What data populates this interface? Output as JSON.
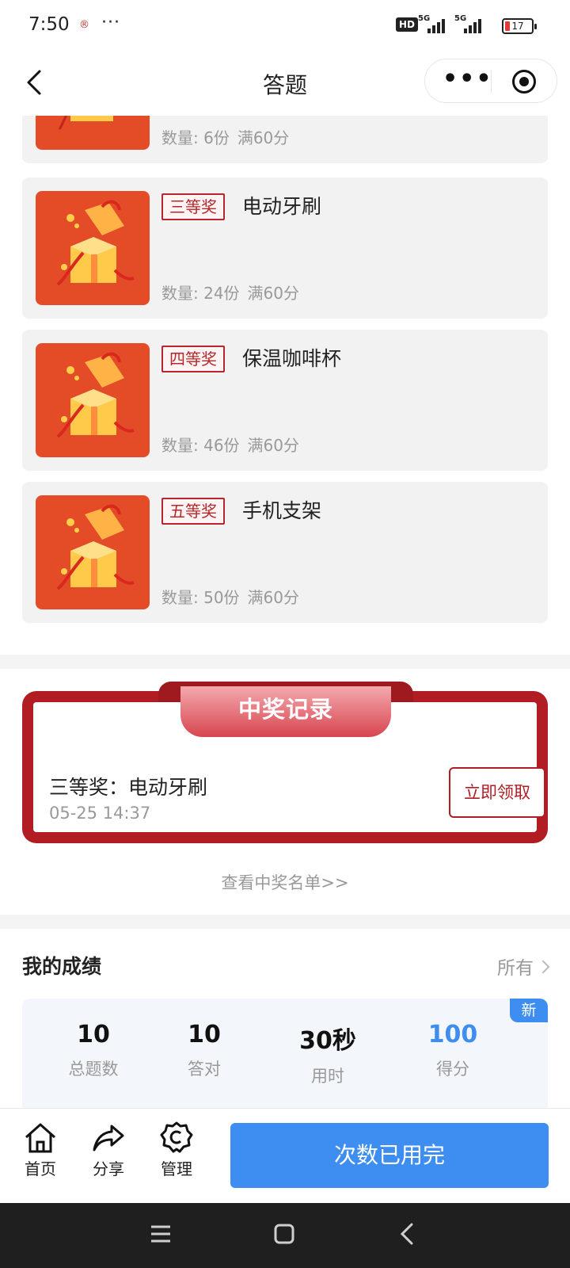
{
  "status_bar": {
    "time": "7:50",
    "app_glyph": "®",
    "dots": "···",
    "hd": "HD",
    "sim1": "5G",
    "sim2": "5G",
    "battery": "17"
  },
  "nav": {
    "title": "答题",
    "more_glyph": "•••"
  },
  "prizes": [
    {
      "badge": "",
      "name": "",
      "quantity": "数量: 6份",
      "threshold": "满60分"
    },
    {
      "badge": "三等奖",
      "name": "电动牙刷",
      "quantity": "数量: 24份",
      "threshold": "满60分"
    },
    {
      "badge": "四等奖",
      "name": "保温咖啡杯",
      "quantity": "数量: 46份",
      "threshold": "满60分"
    },
    {
      "badge": "五等奖",
      "name": "手机支架",
      "quantity": "数量: 50份",
      "threshold": "满60分"
    }
  ],
  "records": {
    "ribbon_title": "中奖记录",
    "entry_title": "三等奖：电动牙刷",
    "entry_time": "05-25 14:37",
    "claim_label": "立即领取",
    "view_list_link": "查看中奖名单>>"
  },
  "scores": {
    "heading": "我的成绩",
    "all_link": "所有",
    "new_tag": "新",
    "stats": [
      {
        "value": "10",
        "label": "总题数"
      },
      {
        "value": "10",
        "label": "答对"
      },
      {
        "value": "30秒",
        "label": "用时"
      },
      {
        "value": "100",
        "label": "得分"
      }
    ]
  },
  "bottom_bar": {
    "home": "首页",
    "share": "分享",
    "manage": "管理",
    "main_button": "次数已用完"
  },
  "colors": {
    "accent_red": "#b11d23",
    "accent_blue": "#3d8ef0",
    "thumb_orange": "#e44c27"
  },
  "icons": [
    "back-icon",
    "more-icon",
    "close-target-icon",
    "home-icon",
    "share-icon",
    "gear-icon",
    "menu-icon",
    "square-icon",
    "triangle-back-icon",
    "gift-box-icon"
  ]
}
